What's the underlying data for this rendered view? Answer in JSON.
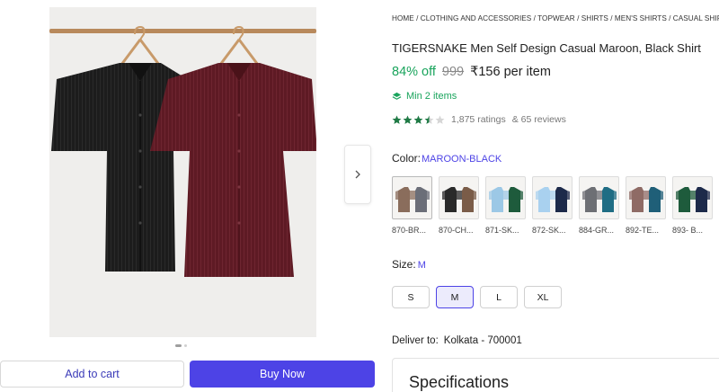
{
  "breadcrumb": "HOME / CLOTHING AND ACCESSORIES / TOPWEAR / SHIRTS / MEN'S SHIRTS / CASUAL SHIRTS / TIG",
  "product": {
    "title": "TIGERSNAKE Men Self Design Casual Maroon, Black Shirt",
    "discount": "84% off",
    "mrp": "999",
    "price": "₹156 per item",
    "min_qty": "Min 2 items",
    "ratings": "1,875 ratings",
    "reviews": "& 65 reviews",
    "rating_value": 3.5
  },
  "color": {
    "label": "Color:",
    "selected": "MAROON-BLACK",
    "options": [
      {
        "caption": "870-BR...",
        "c1": "#8a6d5c",
        "c2": "#6b6e78"
      },
      {
        "caption": "870-CH...",
        "c1": "#2a2a2a",
        "c2": "#7a5c48"
      },
      {
        "caption": "871-SK...",
        "c1": "#9cc8e6",
        "c2": "#1e5b3c"
      },
      {
        "caption": "872-SK...",
        "c1": "#a9d1ef",
        "c2": "#1d2a4a"
      },
      {
        "caption": "884-GR...",
        "c1": "#6d6f74",
        "c2": "#1f6d84"
      },
      {
        "caption": "892-TE...",
        "c1": "#8f6b65",
        "c2": "#1f5f78"
      },
      {
        "caption": "893- B...",
        "c1": "#1e5b3c",
        "c2": "#1d2a4a"
      }
    ]
  },
  "size": {
    "label": "Size:",
    "selected": "M",
    "options": [
      "S",
      "M",
      "L",
      "XL"
    ]
  },
  "deliver": {
    "label": "Deliver to:",
    "location": "Kolkata - 700001"
  },
  "buttons": {
    "add_to_cart": "Add to cart",
    "buy_now": "Buy Now"
  },
  "specifications_title": "Specifications",
  "colors": {
    "accent": "#4d43e6",
    "green": "#19a45c",
    "star": "#1f9d55"
  }
}
